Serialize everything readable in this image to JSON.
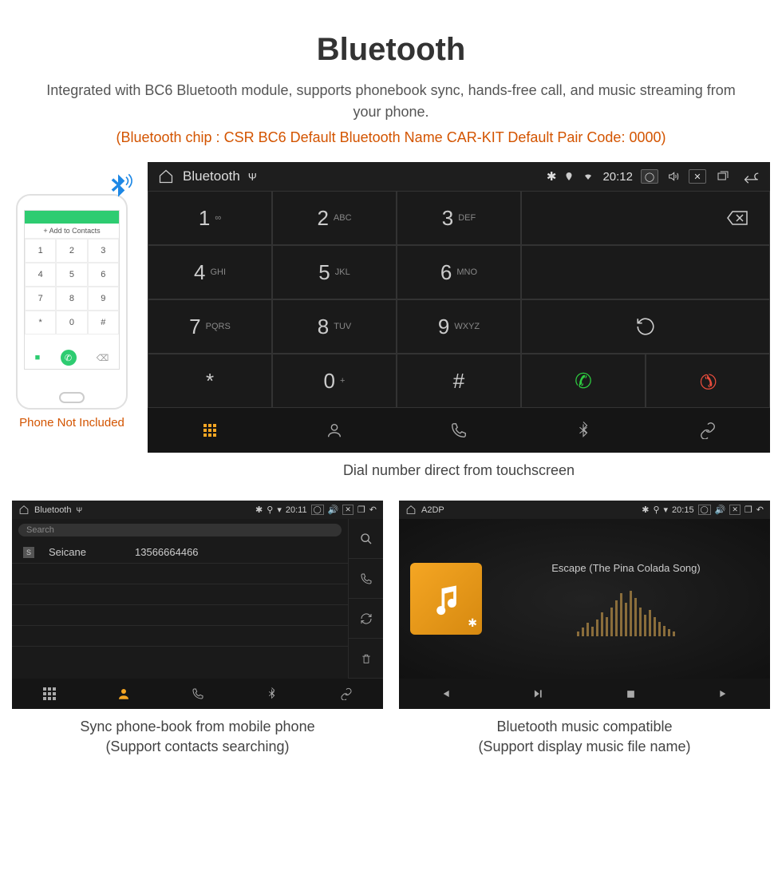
{
  "heading": "Bluetooth",
  "subheading": "Integrated with BC6 Bluetooth module, supports phonebook sync, hands-free call, and music streaming from your phone.",
  "orange_info": "(Bluetooth chip : CSR BC6     Default Bluetooth Name CAR-KIT     Default Pair Code: 0000)",
  "phone": {
    "add_label": "Add to Contacts",
    "keys": [
      "1",
      "2",
      "3",
      "4",
      "5",
      "6",
      "7",
      "8",
      "9",
      "*",
      "0",
      "#"
    ],
    "caption": "Phone Not Included"
  },
  "main": {
    "title": "Bluetooth",
    "time": "20:12",
    "keys": [
      {
        "num": "1",
        "let": "∞"
      },
      {
        "num": "2",
        "let": "ABC"
      },
      {
        "num": "3",
        "let": "DEF"
      },
      {
        "num": "4",
        "let": "GHI"
      },
      {
        "num": "5",
        "let": "JKL"
      },
      {
        "num": "6",
        "let": "MNO"
      },
      {
        "num": "7",
        "let": "PQRS"
      },
      {
        "num": "8",
        "let": "TUV"
      },
      {
        "num": "9",
        "let": "WXYZ"
      },
      {
        "num": "*",
        "let": ""
      },
      {
        "num": "0",
        "let": "+",
        "sup": true
      },
      {
        "num": "#",
        "let": ""
      }
    ],
    "caption": "Dial number direct from touchscreen"
  },
  "contacts": {
    "title": "Bluetooth",
    "time": "20:11",
    "search_placeholder": "Search",
    "row": {
      "badge": "S",
      "name": "Seicane",
      "number": "13566664466"
    },
    "caption_line1": "Sync phone-book from mobile phone",
    "caption_line2": "(Support contacts searching)"
  },
  "music": {
    "title": "A2DP",
    "time": "20:15",
    "track": "Escape (The Pina Colada Song)",
    "caption_line1": "Bluetooth music compatible",
    "caption_line2": "(Support display music file name)"
  }
}
